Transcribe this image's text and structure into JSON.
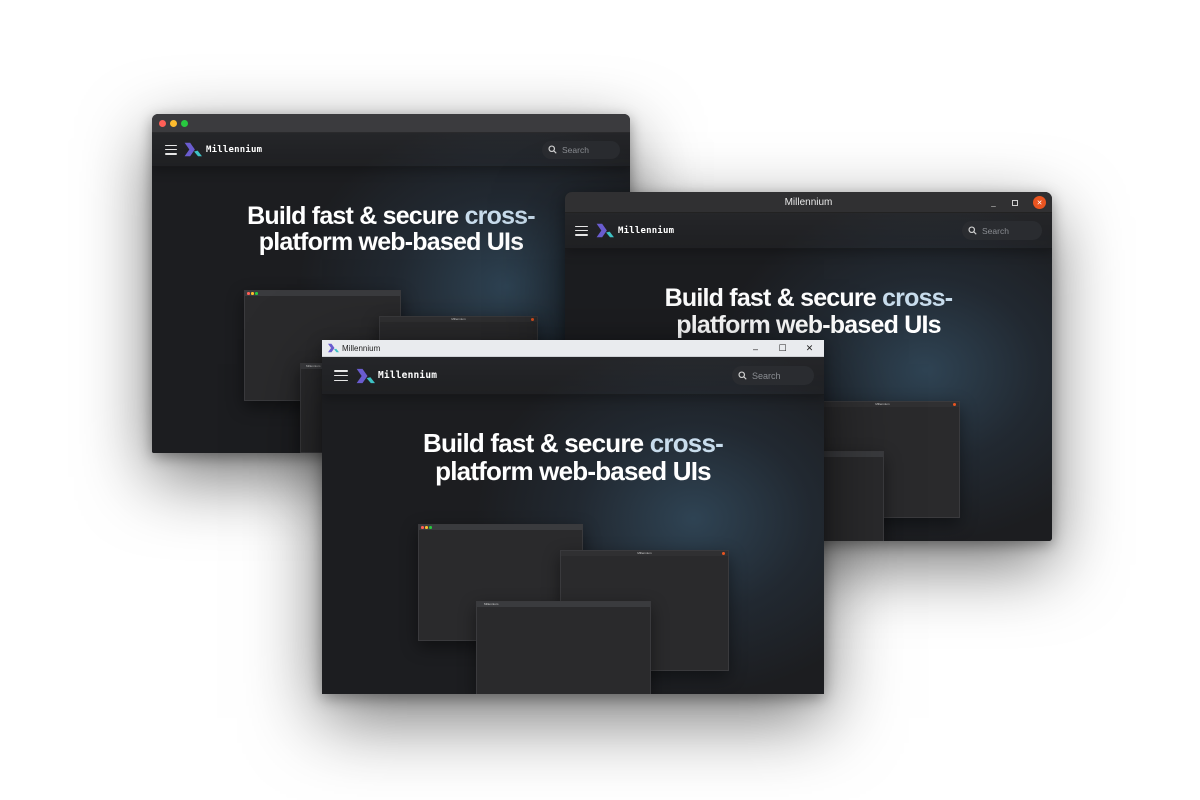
{
  "app": {
    "brand_name": "Millennium",
    "search_placeholder": "Search",
    "hero_line1_white": "Build fast & secure",
    "hero_line1_accent": "cross-",
    "hero_line2": "platform web-based UIs"
  },
  "windows": {
    "mac": {
      "platform": "macOS"
    },
    "linux": {
      "title": "Millennium",
      "minimize_label": "_",
      "maximize_label": "▫",
      "close_label": "✕"
    },
    "win": {
      "title": "Millennium",
      "minimize_label": "–",
      "maximize_label": "☐",
      "close_label": "✕"
    }
  },
  "mini": {
    "title": "Millennium"
  },
  "colors": {
    "background": "#ffffff",
    "page_bg": "#1c1d20",
    "accent_text": "#c8dcec",
    "logo_purple": "#6a5ccf",
    "logo_teal": "#3ec2c5",
    "mac_red": "#ff5f57",
    "mac_yellow": "#febc2e",
    "mac_green": "#28c840",
    "linux_close": "#e95420"
  },
  "icons": [
    "hamburger-menu-icon",
    "millennium-logo-icon",
    "search-icon",
    "mac-close",
    "mac-minimize",
    "mac-zoom",
    "window-minimize-icon",
    "window-maximize-icon",
    "window-close-icon"
  ]
}
